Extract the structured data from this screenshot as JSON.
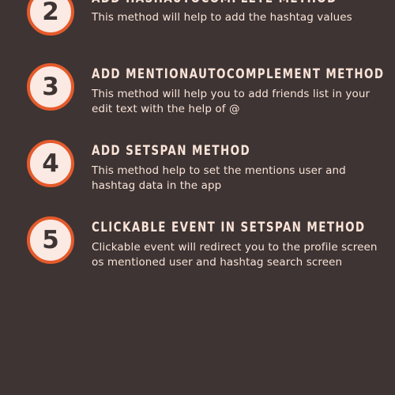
{
  "steps": [
    {
      "number": "2",
      "title": "ADD HASHAUTOCOMPLETE METHOD",
      "description": "This method will help to add the hashtag values"
    },
    {
      "number": "3",
      "title": "ADD MENTIONAUTOCOMPLEMENT METHOD",
      "description": "This method will help you to add friends list in your edit text with the help of @"
    },
    {
      "number": "4",
      "title": "ADD SETSPAN METHOD",
      "description": "This method help to set the mentions user and hashtag data in the app"
    },
    {
      "number": "5",
      "title": "CLICKABLE EVENT IN SETSPAN METHOD",
      "description": "Clickable event will redirect you to the profile screen os mentioned user and hashtag search screen"
    }
  ],
  "colors": {
    "background": "#3d3433",
    "badge_fill": "#fbe9e3",
    "badge_ring": "#e55a2b",
    "text": "#fbe3d8"
  }
}
